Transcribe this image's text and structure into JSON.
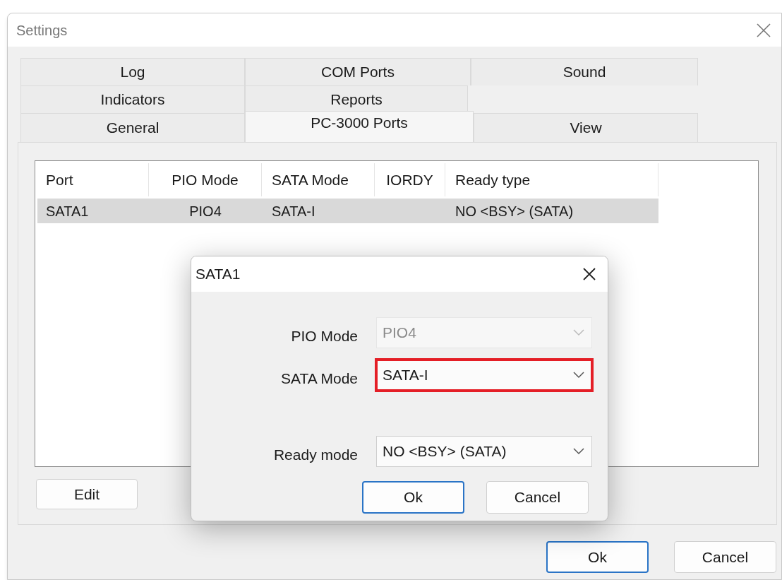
{
  "window": {
    "title": "Settings"
  },
  "tab_rows": [
    [
      {
        "label": "Log",
        "selected": false
      },
      {
        "label": "COM Ports",
        "selected": false
      },
      {
        "label": "Sound",
        "selected": false
      }
    ],
    [
      {
        "label": "Indicators",
        "selected": false
      },
      {
        "label": "Reports",
        "selected": false
      }
    ],
    [
      {
        "label": "General",
        "selected": false
      },
      {
        "label": "PC-3000 Ports",
        "selected": true
      },
      {
        "label": "View",
        "selected": false
      }
    ]
  ],
  "table": {
    "columns": [
      "Port",
      "PIO Mode",
      "SATA Mode",
      "IORDY",
      "Ready type"
    ],
    "rows": [
      {
        "cells": [
          "SATA1",
          "PIO4",
          "SATA-I",
          "",
          "NO <BSY> (SATA)"
        ],
        "selected": true
      }
    ]
  },
  "edit_button": "Edit",
  "buttons": [
    {
      "label": "Ok",
      "default": true
    },
    {
      "label": "Cancel",
      "default": false
    }
  ],
  "dialog": {
    "title": "SATA1",
    "fields": [
      {
        "label": "PIO Mode",
        "value": "PIO4",
        "disabled": true,
        "highlighted": false
      },
      {
        "label": "SATA Mode",
        "value": "SATA-I",
        "disabled": false,
        "highlighted": true
      },
      {
        "label": "Ready mode",
        "value": "NO <BSY> (SATA)",
        "disabled": false,
        "highlighted": false
      }
    ],
    "buttons": [
      {
        "label": "Ok",
        "default": true
      },
      {
        "label": "Cancel",
        "default": false
      }
    ]
  }
}
